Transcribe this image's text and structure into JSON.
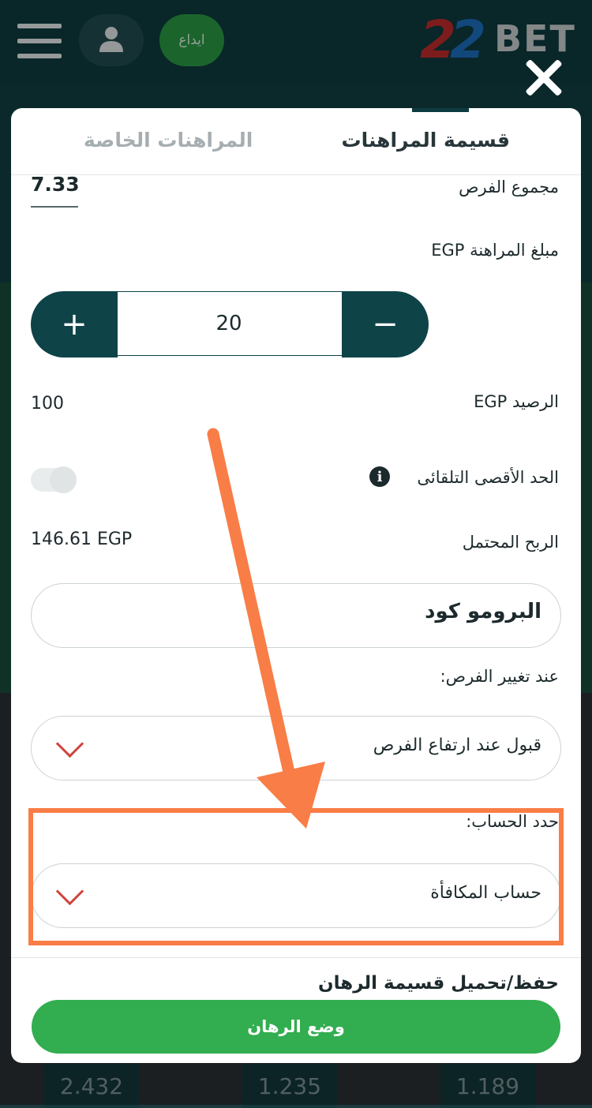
{
  "header": {
    "deposit_label": "ايداع",
    "logo_number": "22",
    "logo_word": "BET"
  },
  "background_odds": [
    "2.432",
    "1.235",
    "1.189"
  ],
  "tabs": {
    "bet_slip": "قسيمة المراهنات",
    "special_bets": "المراهنات الخاصة"
  },
  "slip": {
    "total_odds_label": "مجموع الفرص",
    "total_odds_value": "7.33",
    "stake_label": "مبلغ المراهنة EGP",
    "stake_value": "20",
    "plus_symbol": "+",
    "minus_symbol": "−",
    "balance_label": "الرصيد EGP",
    "balance_value": "100",
    "auto_max_label": "الحد الأقصى التلقائى",
    "auto_max_enabled": false,
    "potential_win_label": "الربح المحتمل",
    "potential_win_value": "146.61 EGP",
    "promo_code_label": "البرومو كود",
    "odds_change_label": "عند تغيير الفرص:",
    "odds_change_value": "قبول عند ارتفاع الفرص",
    "account_label": "حدد الحساب:",
    "account_value": "حساب المكافأة",
    "save_load_label": "حفظ/تحميل قسيمة الرهان",
    "place_bet_label": "وضع الرهان"
  },
  "annotation": {
    "color": "#f97d46"
  }
}
